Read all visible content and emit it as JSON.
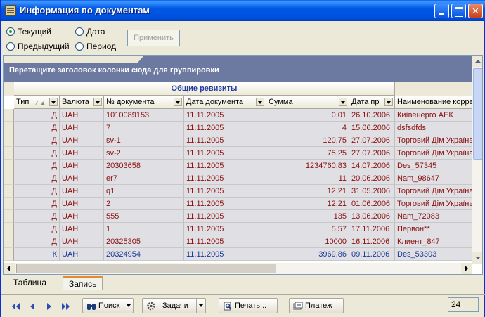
{
  "window": {
    "title": "Информация по документам"
  },
  "period": {
    "current_label": "Текущий",
    "date_label": "Дата",
    "previous_label": "Предыдущий",
    "period_label": "Период",
    "apply_label": "Применить",
    "selected": "current"
  },
  "grid": {
    "group_hint": "Перетащите заголовок колонки сюда для группировки",
    "band_label": "Общие ревизиты",
    "columns": [
      "Тип",
      "Валюта",
      "№ документа",
      "Дата документа",
      "Сумма",
      "Дата пр",
      "Наименование корре"
    ],
    "rows": [
      {
        "type": "Д",
        "currency": "UAH",
        "doc_no": "1010089153",
        "doc_date": "11.11.2005",
        "amount": "0,01",
        "pay_date": "26.10.2006",
        "name": "Київенерго АЕК",
        "color": "red"
      },
      {
        "type": "Д",
        "currency": "UAH",
        "doc_no": "7",
        "doc_date": "11.11.2005",
        "amount": "4",
        "pay_date": "15.06.2006",
        "name": "dsfsdfds",
        "color": "red"
      },
      {
        "type": "Д",
        "currency": "UAH",
        "doc_no": "sv-1",
        "doc_date": "11.11.2005",
        "amount": "120,75",
        "pay_date": "27.07.2006",
        "name": "Торговий Дім Україна",
        "color": "red"
      },
      {
        "type": "Д",
        "currency": "UAH",
        "doc_no": "sv-2",
        "doc_date": "11.11.2005",
        "amount": "75,25",
        "pay_date": "27.07.2006",
        "name": "Торговий Дім Україна",
        "color": "red"
      },
      {
        "type": "Д",
        "currency": "UAH",
        "doc_no": "20303658",
        "doc_date": "11.11.2005",
        "amount": "1234760,83",
        "pay_date": "14.07.2006",
        "name": "Des_57345",
        "color": "red"
      },
      {
        "type": "Д",
        "currency": "UAH",
        "doc_no": "er7",
        "doc_date": "11.11.2005",
        "amount": "11",
        "pay_date": "20.06.2006",
        "name": "Nam_98647",
        "color": "red"
      },
      {
        "type": "Д",
        "currency": "UAH",
        "doc_no": "q1",
        "doc_date": "11.11.2005",
        "amount": "12,21",
        "pay_date": "31.05.2006",
        "name": "Торговий Дім Україна",
        "color": "red"
      },
      {
        "type": "Д",
        "currency": "UAH",
        "doc_no": "2",
        "doc_date": "11.11.2005",
        "amount": "12,21",
        "pay_date": "01.06.2006",
        "name": "Торговий Дім Україна",
        "color": "red"
      },
      {
        "type": "Д",
        "currency": "UAH",
        "doc_no": "555",
        "doc_date": "11.11.2005",
        "amount": "135",
        "pay_date": "13.06.2006",
        "name": "Nam_72083",
        "color": "red"
      },
      {
        "type": "Д",
        "currency": "UAH",
        "doc_no": "1",
        "doc_date": "11.11.2005",
        "amount": "5,57",
        "pay_date": "17.11.2006",
        "name": "Первон**",
        "color": "red"
      },
      {
        "type": "Д",
        "currency": "UAH",
        "doc_no": "20325305",
        "doc_date": "11.11.2005",
        "amount": "10000",
        "pay_date": "16.11.2006",
        "name": "Клиент_847",
        "color": "red"
      },
      {
        "type": "К",
        "currency": "UAH",
        "doc_no": "20324954",
        "doc_date": "11.11.2005",
        "amount": "3969,86",
        "pay_date": "09.11.2006",
        "name": "Des_53303",
        "color": "blue"
      }
    ]
  },
  "tabs": {
    "table_label": "Таблица",
    "record_label": "Запись",
    "active": "record"
  },
  "toolbar": {
    "search_label": "Поиск",
    "tasks_label": "Задачи",
    "print_label": "Печать...",
    "payment_label": "Платеж",
    "record_count": "24"
  },
  "colors": {
    "title_bar": "#0058E6",
    "group_panel": "#6C7AA2",
    "debit_text": "#8A1010",
    "credit_text": "#1A3A9A",
    "band_text": "#243CA0"
  }
}
